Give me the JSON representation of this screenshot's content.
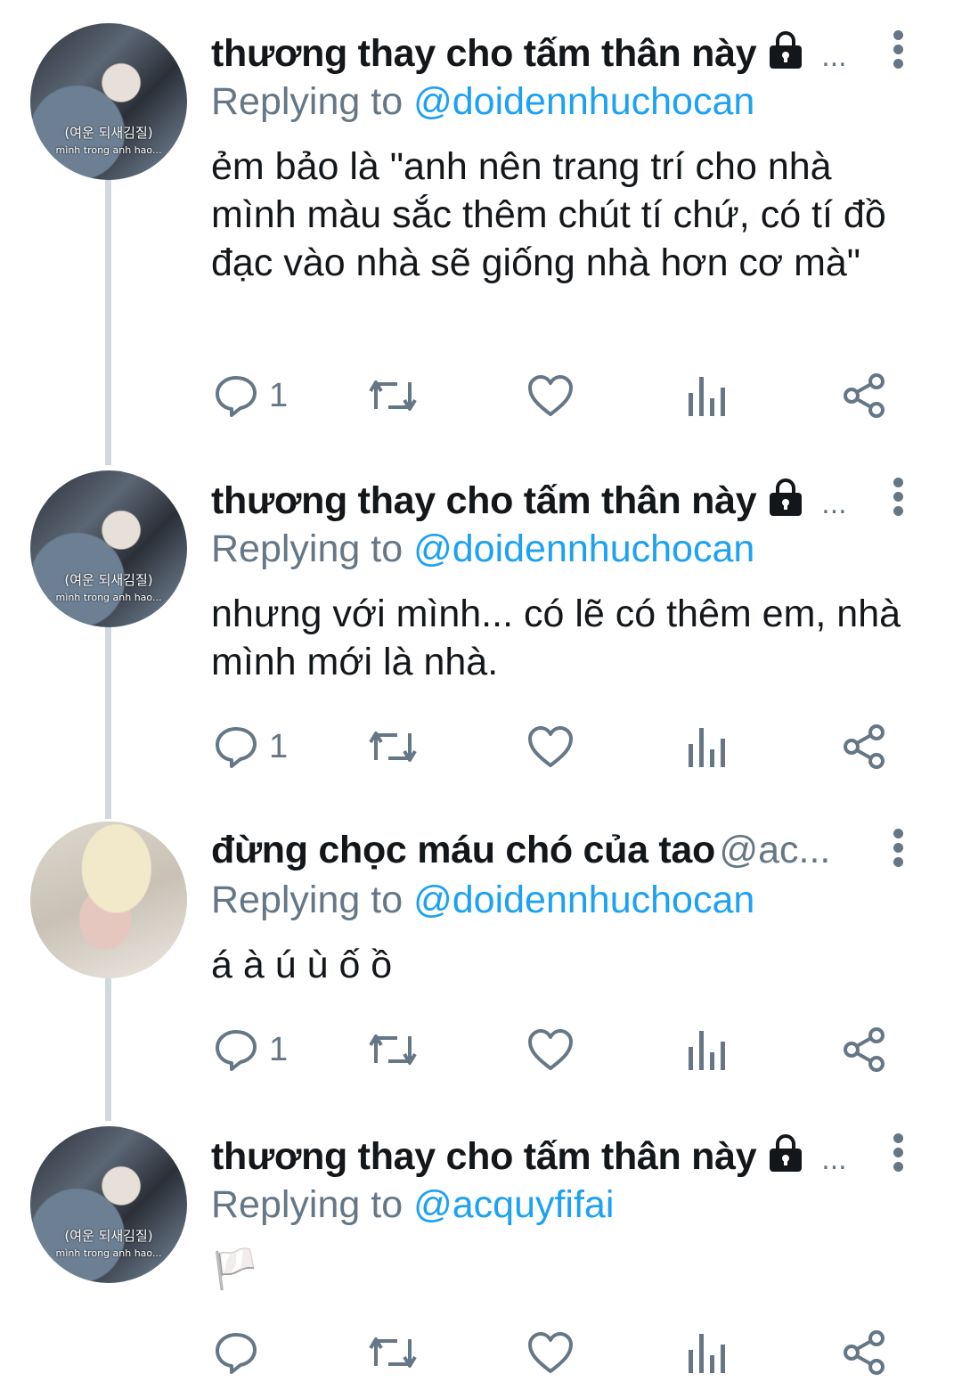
{
  "tweets": [
    {
      "display_name": "thương thay cho tấm thân này",
      "locked": true,
      "handle": "...",
      "replying_label": "Replying to",
      "replying_handle": "@doidennhuchocan",
      "text": "ẻm bảo là \"anh nên trang trí cho nhà mình màu sắc thêm chút tí chứ, có tí đồ đạc vào nhà sẽ giống nhà hơn cơ mà\"",
      "reply_count": "1",
      "avatar_caption_1": "(여운 되새김질)",
      "avatar_caption_2": "mình trong anh hao..."
    },
    {
      "display_name": "thương thay cho tấm thân này",
      "locked": true,
      "handle": "...",
      "replying_label": "Replying to",
      "replying_handle": "@doidennhuchocan",
      "text": "nhưng với mình... có lẽ có thêm em, nhà mình mới là nhà.",
      "reply_count": "1",
      "avatar_caption_1": "(여운 되새김질)",
      "avatar_caption_2": "mình trong anh hao..."
    },
    {
      "display_name": "đừng chọc máu chó của tao",
      "locked": false,
      "handle": "@ac...",
      "replying_label": "Replying to",
      "replying_handle": "@doidennhuchocan",
      "text": "á à ú ù ố ồ",
      "reply_count": "1"
    },
    {
      "display_name": "thương thay cho tấm thân này",
      "locked": true,
      "handle": "...",
      "replying_label": "Replying to",
      "replying_handle": "@acquyfifai",
      "text": "🏳️",
      "reply_count": "",
      "avatar_caption_1": "(여운 되새김질)",
      "avatar_caption_2": "mình trong anh hao..."
    }
  ],
  "colors": {
    "text": "#14171a",
    "secondary": "#657786",
    "link": "#1da1f2",
    "thread_line": "#cfd9de"
  },
  "icons": [
    "lock-icon",
    "more-options-icon",
    "reply-icon",
    "retweet-icon",
    "like-icon",
    "analytics-icon",
    "share-icon"
  ]
}
